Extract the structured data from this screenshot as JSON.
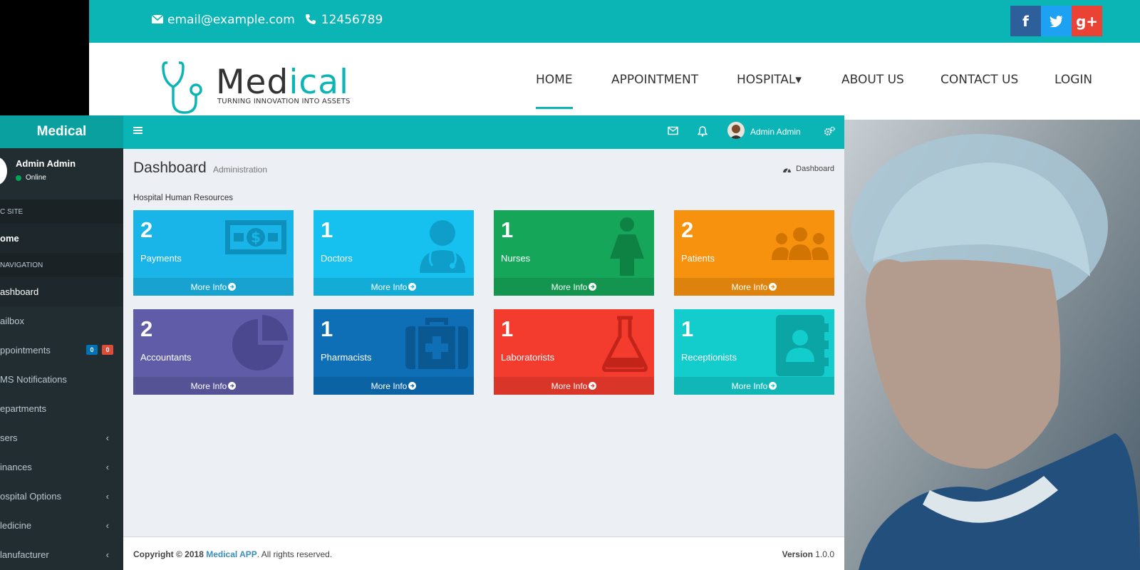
{
  "site": {
    "email": "email@example.com",
    "phone": "12456789",
    "social": [
      {
        "label": "f",
        "icon": "facebook-icon",
        "color": "#2d5f9a"
      },
      {
        "label": "t",
        "icon": "twitter-icon",
        "color": "#1da1f2"
      },
      {
        "label": "g+",
        "icon": "google-plus-icon",
        "color": "#ea4335"
      }
    ],
    "logo": {
      "part1": "Med",
      "part2": "ical",
      "tagline": "TURNING INNOVATION INTO ASSETS"
    },
    "menu": [
      {
        "label": "HOME",
        "active": true
      },
      {
        "label": "APPOINTMENT"
      },
      {
        "label": "HOSPITAL▾"
      },
      {
        "label": "ABOUT US"
      },
      {
        "label": "CONTACT US"
      },
      {
        "label": "LOGIN"
      }
    ]
  },
  "sidebar": {
    "brand": "Medical",
    "user_name": "Admin Admin",
    "user_status": "Online",
    "header_public": "C SITE",
    "home": "ome",
    "header_nav": "NAVIGATION",
    "items": [
      {
        "label": "ashboard"
      },
      {
        "label": "ailbox"
      },
      {
        "label": "ppointments",
        "badge1": "0",
        "badge2": "0"
      },
      {
        "label": "MS Notifications"
      },
      {
        "label": "epartments"
      },
      {
        "label": "sers"
      },
      {
        "label": "inances"
      },
      {
        "label": "ospital Options"
      },
      {
        "label": "ledicine"
      },
      {
        "label": "lanufacturer"
      }
    ]
  },
  "header": {
    "user_name": "Admin Admin"
  },
  "page": {
    "title": "Dashboard",
    "subtitle": "Administration",
    "breadcrumb": "Dashboard",
    "section": "Hospital Human Resources"
  },
  "boxes": [
    {
      "count": "2",
      "label": "Payments",
      "more": "More Info",
      "icon": "money-icon",
      "color": "#1ab5e8"
    },
    {
      "count": "1",
      "label": "Doctors",
      "more": "More Info",
      "icon": "doctor-icon",
      "color": "#16c0ef"
    },
    {
      "count": "1",
      "label": "Nurses",
      "more": "More Info",
      "icon": "female-icon",
      "color": "#16a65a"
    },
    {
      "count": "2",
      "label": "Patients",
      "more": "More Info",
      "icon": "users-icon",
      "color": "#f7920f"
    },
    {
      "count": "2",
      "label": "Accountants",
      "more": "More Info",
      "icon": "pie-chart-icon",
      "color": "#605ca8"
    },
    {
      "count": "1",
      "label": "Pharmacists",
      "more": "More Info",
      "icon": "medkit-icon",
      "color": "#0e6fb7"
    },
    {
      "count": "1",
      "label": "Laboratorists",
      "more": "More Info",
      "icon": "flask-icon",
      "color": "#f33b2e"
    },
    {
      "count": "1",
      "label": "Receptionists",
      "more": "More Info",
      "icon": "address-book-icon",
      "color": "#13cccc"
    }
  ],
  "footer": {
    "copy_prefix": "Copyright © 2018 ",
    "app_name": "Medical APP",
    "copy_suffix": ". All rights reserved.",
    "version_label": "Version",
    "version": " 1.0.0"
  }
}
